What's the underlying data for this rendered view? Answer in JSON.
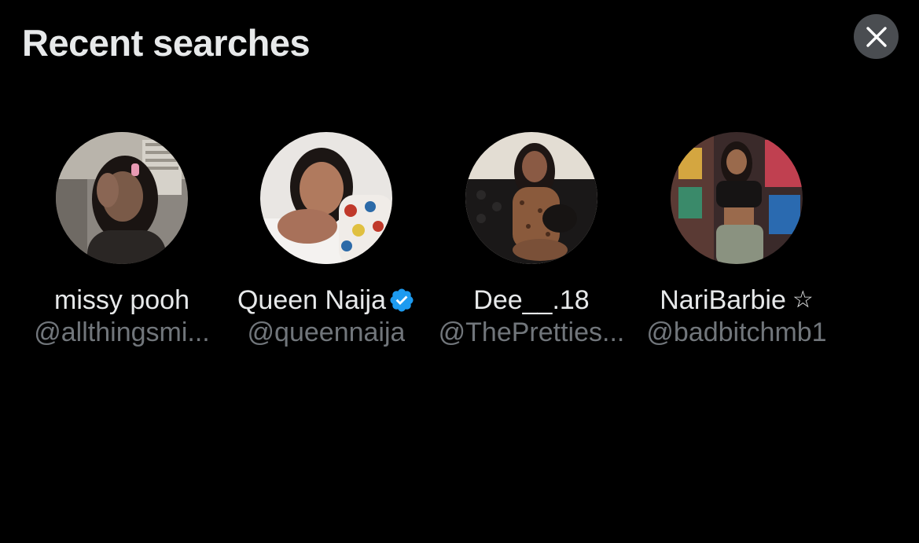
{
  "header": {
    "title": "Recent searches",
    "close_icon": "close-icon"
  },
  "colors": {
    "background": "#000000",
    "primary_text": "#e7e9ea",
    "secondary_text": "#71767b",
    "close_button_bg": "#4a4d51",
    "verified_blue": "#1d9bf0"
  },
  "recent_searches": [
    {
      "name": "missy pooh",
      "handle": "@allthingsmi...",
      "verified": false,
      "badge": ""
    },
    {
      "name": "Queen Naija",
      "handle": "@queennaija",
      "verified": true,
      "badge": "verified-badge-icon"
    },
    {
      "name": "Dee__.18",
      "handle": "@ThePretties...",
      "verified": false,
      "badge": ""
    },
    {
      "name": "NariBarbie",
      "handle": "@badbitchmb1",
      "verified": false,
      "badge": "☆"
    }
  ]
}
